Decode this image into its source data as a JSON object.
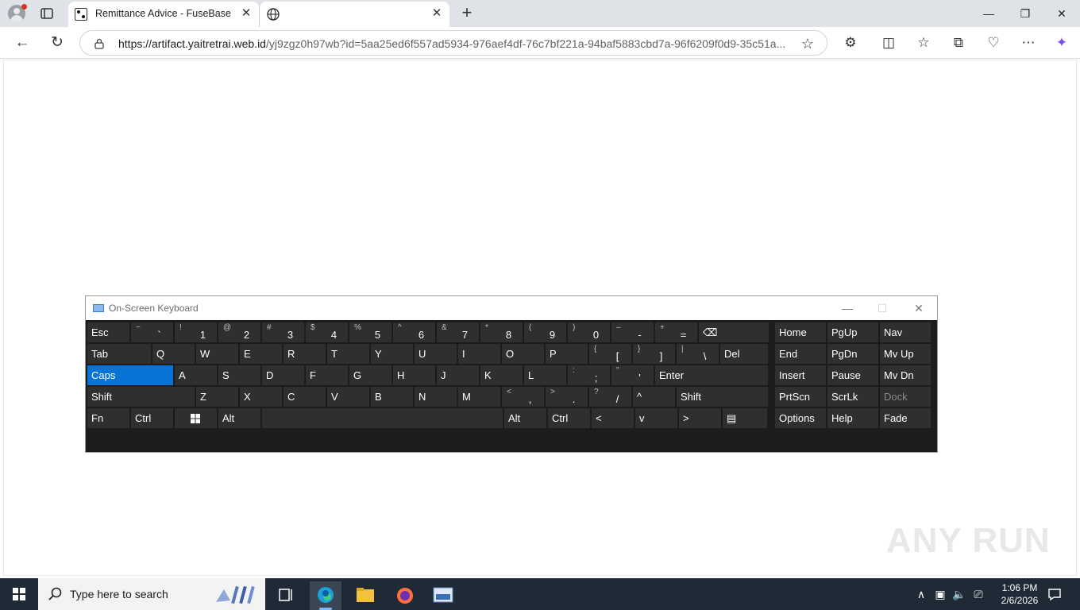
{
  "browser": {
    "tabs": [
      {
        "title": "Remittance Advice - FuseBase",
        "active": true
      },
      {
        "title": "",
        "active": false
      }
    ],
    "url_host": "https://artifact.yaitretrai.web.id",
    "url_path": "/yj9zgz0h97wb?id=5aa25ed6f557ad5934-976aef4df-76c7bf221a-94baf5883cbd7a-96f6209f0d9-35c51a..."
  },
  "osk": {
    "title": "On-Screen Keyboard",
    "rows": [
      [
        {
          "m": "Esc"
        },
        {
          "s": "~",
          "p": "`"
        },
        {
          "s": "!",
          "p": "1"
        },
        {
          "s": "@",
          "p": "2"
        },
        {
          "s": "#",
          "p": "3"
        },
        {
          "s": "$",
          "p": "4"
        },
        {
          "s": "%",
          "p": "5"
        },
        {
          "s": "^",
          "p": "6"
        },
        {
          "s": "&",
          "p": "7"
        },
        {
          "s": "*",
          "p": "8"
        },
        {
          "s": "(",
          "p": "9"
        },
        {
          "s": ")",
          "p": "0"
        },
        {
          "s": "–",
          "p": "-"
        },
        {
          "s": "+",
          "p": "="
        },
        {
          "m": "⌫"
        },
        {
          "m": "Home"
        },
        {
          "m": "PgUp"
        },
        {
          "m": "Nav"
        }
      ],
      [
        {
          "m": "Tab"
        },
        {
          "m": "Q"
        },
        {
          "m": "W"
        },
        {
          "m": "E"
        },
        {
          "m": "R"
        },
        {
          "m": "T"
        },
        {
          "m": "Y"
        },
        {
          "m": "U"
        },
        {
          "m": "I"
        },
        {
          "m": "O"
        },
        {
          "m": "P"
        },
        {
          "s": "{",
          "p": "["
        },
        {
          "s": "}",
          "p": "]"
        },
        {
          "s": "|",
          "p": "\\"
        },
        {
          "m": "Del"
        },
        {
          "m": "End"
        },
        {
          "m": "PgDn"
        },
        {
          "m": "Mv Up"
        }
      ],
      [
        {
          "m": "Caps"
        },
        {
          "m": "A"
        },
        {
          "m": "S"
        },
        {
          "m": "D"
        },
        {
          "m": "F"
        },
        {
          "m": "G"
        },
        {
          "m": "H"
        },
        {
          "m": "J"
        },
        {
          "m": "K"
        },
        {
          "m": "L"
        },
        {
          "s": ":",
          "p": ";"
        },
        {
          "s": "\"",
          "p": "'"
        },
        {
          "m": "Enter"
        },
        {
          "m": "Insert"
        },
        {
          "m": "Pause"
        },
        {
          "m": "Mv Dn"
        }
      ],
      [
        {
          "m": "Shift"
        },
        {
          "m": "Z"
        },
        {
          "m": "X"
        },
        {
          "m": "C"
        },
        {
          "m": "V"
        },
        {
          "m": "B"
        },
        {
          "m": "N"
        },
        {
          "m": "M"
        },
        {
          "s": "<",
          "p": ","
        },
        {
          "s": ">",
          "p": "."
        },
        {
          "s": "?",
          "p": "/"
        },
        {
          "m": "^"
        },
        {
          "m": "Shift"
        },
        {
          "m": "PrtScn"
        },
        {
          "m": "ScrLk"
        },
        {
          "m": "Dock"
        }
      ],
      [
        {
          "m": "Fn"
        },
        {
          "m": "Ctrl"
        },
        {
          "m": ""
        },
        {
          "m": "Alt"
        },
        {
          "m": ""
        },
        {
          "m": "Alt"
        },
        {
          "m": "Ctrl"
        },
        {
          "m": "<"
        },
        {
          "m": "v"
        },
        {
          "m": ">"
        },
        {
          "m": "▤"
        },
        {
          "m": "Options"
        },
        {
          "m": "Help"
        },
        {
          "m": "Fade"
        }
      ]
    ]
  },
  "taskbar": {
    "search_placeholder": "Type here to search",
    "time": "1:06 PM",
    "date": "2/6/2026"
  },
  "watermark": "ANY RUN"
}
